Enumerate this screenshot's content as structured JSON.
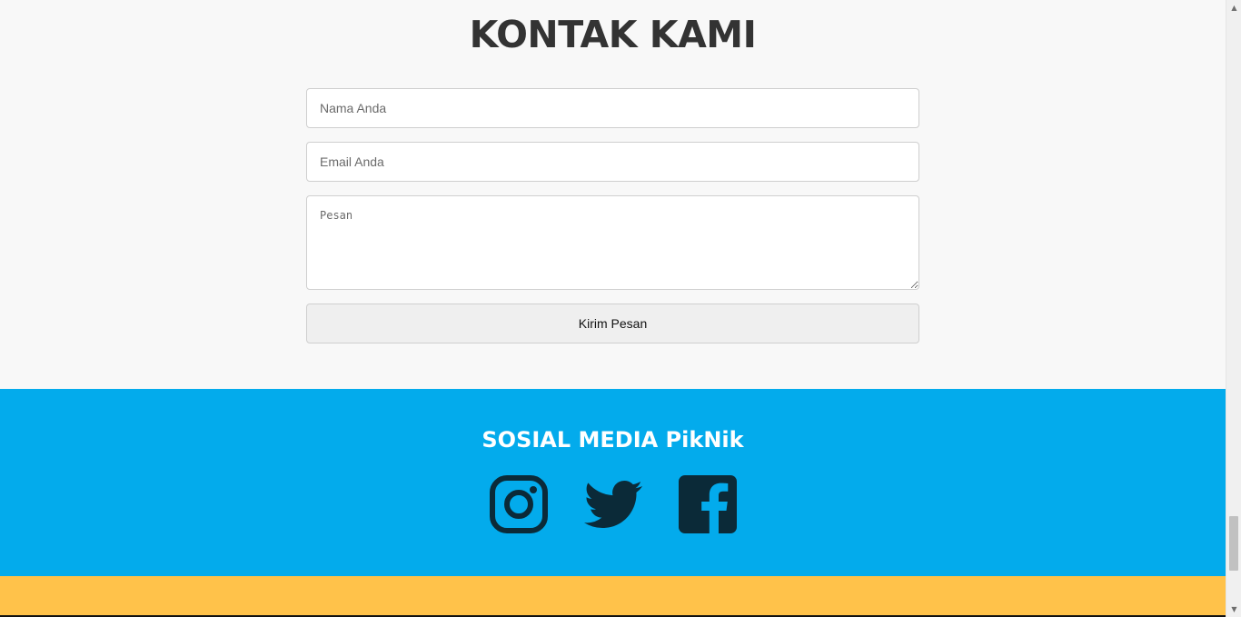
{
  "contact": {
    "title": "KONTAK KAMI",
    "name_placeholder": "Nama Anda",
    "email_placeholder": "Email Anda",
    "message_placeholder": "Pesan",
    "submit_label": "Kirim Pesan"
  },
  "social": {
    "title": "SOSIAL MEDIA PikNik",
    "icons": [
      "instagram-icon",
      "twitter-icon",
      "facebook-icon"
    ]
  },
  "colors": {
    "contact_bg": "#f8f8f8",
    "social_bg": "#03abec",
    "footer_bg": "#ffc24a",
    "icon_color": "#0b2a38"
  }
}
